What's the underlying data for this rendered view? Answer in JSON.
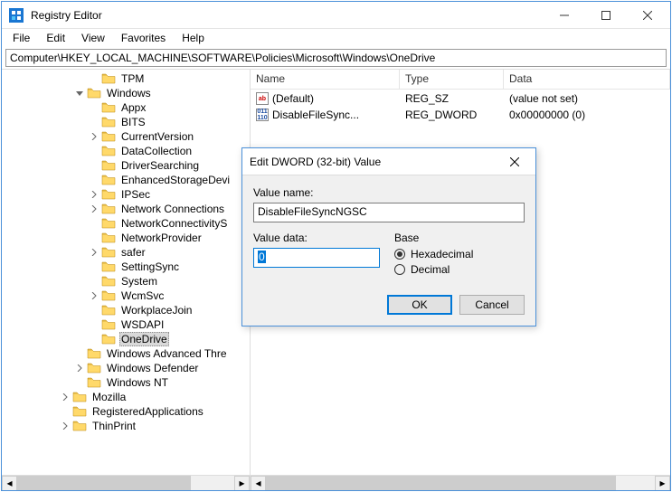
{
  "window": {
    "title": "Registry Editor"
  },
  "menu": {
    "file": "File",
    "edit": "Edit",
    "view": "View",
    "favorites": "Favorites",
    "help": "Help"
  },
  "path": "Computer\\HKEY_LOCAL_MACHINE\\SOFTWARE\\Policies\\Microsoft\\Windows\\OneDrive",
  "tree": [
    {
      "indent": 6,
      "expander": "",
      "label": "TPM"
    },
    {
      "indent": 5,
      "expander": "v",
      "label": "Windows"
    },
    {
      "indent": 6,
      "expander": "",
      "label": "Appx"
    },
    {
      "indent": 6,
      "expander": "",
      "label": "BITS"
    },
    {
      "indent": 6,
      "expander": ">",
      "label": "CurrentVersion"
    },
    {
      "indent": 6,
      "expander": "",
      "label": "DataCollection"
    },
    {
      "indent": 6,
      "expander": "",
      "label": "DriverSearching"
    },
    {
      "indent": 6,
      "expander": "",
      "label": "EnhancedStorageDevi"
    },
    {
      "indent": 6,
      "expander": ">",
      "label": "IPSec"
    },
    {
      "indent": 6,
      "expander": ">",
      "label": "Network Connections"
    },
    {
      "indent": 6,
      "expander": "",
      "label": "NetworkConnectivityS"
    },
    {
      "indent": 6,
      "expander": "",
      "label": "NetworkProvider"
    },
    {
      "indent": 6,
      "expander": ">",
      "label": "safer"
    },
    {
      "indent": 6,
      "expander": "",
      "label": "SettingSync"
    },
    {
      "indent": 6,
      "expander": "",
      "label": "System"
    },
    {
      "indent": 6,
      "expander": ">",
      "label": "WcmSvc"
    },
    {
      "indent": 6,
      "expander": "",
      "label": "WorkplaceJoin"
    },
    {
      "indent": 6,
      "expander": "",
      "label": "WSDAPI"
    },
    {
      "indent": 6,
      "expander": "",
      "label": "OneDrive",
      "selected": true
    },
    {
      "indent": 5,
      "expander": "",
      "label": "Windows Advanced Thre"
    },
    {
      "indent": 5,
      "expander": ">",
      "label": "Windows Defender"
    },
    {
      "indent": 5,
      "expander": "",
      "label": "Windows NT"
    },
    {
      "indent": 4,
      "expander": ">",
      "label": "Mozilla"
    },
    {
      "indent": 4,
      "expander": "",
      "label": "RegisteredApplications"
    },
    {
      "indent": 4,
      "expander": ">",
      "label": "ThinPrint"
    }
  ],
  "columns": {
    "name": "Name",
    "type": "Type",
    "data": "Data"
  },
  "values": [
    {
      "icon": "string",
      "name": "(Default)",
      "type": "REG_SZ",
      "data": "(value not set)"
    },
    {
      "icon": "dword",
      "name": "DisableFileSync...",
      "type": "REG_DWORD",
      "data": "0x00000000 (0)"
    }
  ],
  "dialog": {
    "title": "Edit DWORD (32-bit) Value",
    "value_name_label": "Value name:",
    "value_name": "DisableFileSyncNGSC",
    "value_data_label": "Value data:",
    "value_data": "0",
    "base_label": "Base",
    "hex": "Hexadecimal",
    "dec": "Decimal",
    "ok": "OK",
    "cancel": "Cancel"
  }
}
